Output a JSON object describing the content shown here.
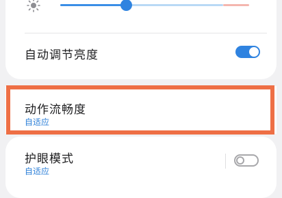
{
  "brightness": {
    "level": 0.38,
    "icon": "sun-icon"
  },
  "auto_brightness": {
    "label": "自动调节亮度",
    "enabled": true
  },
  "animation_smoothness": {
    "title": "动作流畅度",
    "value": "自适应"
  },
  "eye_comfort": {
    "title": "护眼模式",
    "value": "自适应",
    "enabled": false
  },
  "colors": {
    "accent": "#2f83e0",
    "highlight": "#ee6f45"
  }
}
